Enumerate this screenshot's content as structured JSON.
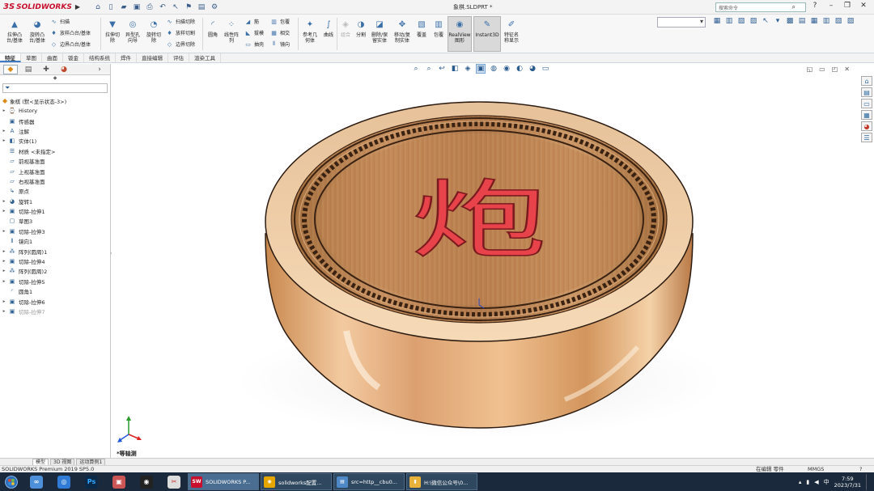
{
  "titlebar": {
    "app_brand": "SOLIDWORKS",
    "brand_prefix": "3S",
    "doc_title": "象棋.SLDPRT *",
    "search_placeholder": "搜索命令"
  },
  "ribbon": {
    "extrude_boss": "拉伸凸\n台/基体",
    "revolve_boss": "旋转凸\n台/基体",
    "sweep": "扫描",
    "loft_boss": "放样凸台/基体",
    "boundary_boss": "边界凸台/基体",
    "extrude_cut": "拉伸切\n除",
    "hole_wizard": "异型孔\n向导",
    "revolve_cut": "旋转切\n除",
    "sweep_cut": "扫描切除",
    "loft_cut": "放样切割",
    "boundary_cut": "边界切除",
    "fillet": "圆角",
    "linear_pattern": "线性阵\n列",
    "rib": "筋",
    "draft": "拔模",
    "shell": "抽壳",
    "wrap": "包覆",
    "intersect": "相交",
    "mirror": "镜向",
    "ref_geometry": "参考几\n何体",
    "curves": "曲线",
    "combine": "组合",
    "split": "分割",
    "delete_keep_body": "删除/保\n留实体",
    "move_copy_body": "移动/复\n制实体",
    "coat": "覆盖",
    "wrap2": "包覆",
    "realview": "RealView\n图形",
    "instant3d": "Instant3D",
    "feature_params": "特征名\n称显示"
  },
  "tabs": [
    "特征",
    "草图",
    "曲面",
    "钣金",
    "结构系统",
    "焊件",
    "直接编辑",
    "评估",
    "渲染工具"
  ],
  "tree": {
    "root": "象棋 (默<显示状态-3>)",
    "items": [
      {
        "label": "History",
        "exp": "▸",
        "icon": "history-icon",
        "glyph": "⌚"
      },
      {
        "label": "传感器",
        "exp": "",
        "icon": "sensor-icon",
        "glyph": "▣"
      },
      {
        "label": "注解",
        "exp": "▸",
        "icon": "annotation-icon",
        "glyph": "A"
      },
      {
        "label": "实体(1)",
        "exp": "▸",
        "icon": "solid-bodies-icon",
        "glyph": "◧"
      },
      {
        "label": "材质 <未指定>",
        "exp": "",
        "icon": "material-icon",
        "glyph": "☰"
      },
      {
        "label": "前视基准面",
        "exp": "",
        "icon": "plane-icon",
        "glyph": "▱"
      },
      {
        "label": "上视基准面",
        "exp": "",
        "icon": "plane-icon",
        "glyph": "▱"
      },
      {
        "label": "右视基准面",
        "exp": "",
        "icon": "plane-icon",
        "glyph": "▱"
      },
      {
        "label": "原点",
        "exp": "",
        "icon": "origin-icon",
        "glyph": "↳"
      },
      {
        "label": "旋转1",
        "exp": "▸",
        "icon": "revolve-icon",
        "glyph": "◕"
      },
      {
        "label": "切除-拉伸1",
        "exp": "▸",
        "icon": "extrude-cut-icon",
        "glyph": "▣"
      },
      {
        "label": "草图3",
        "exp": "",
        "icon": "sketch-icon",
        "glyph": "▢"
      },
      {
        "label": "切除-拉伸3",
        "exp": "▸",
        "icon": "extrude-cut-icon",
        "glyph": "▣"
      },
      {
        "label": "镜向1",
        "exp": "",
        "icon": "mirror-icon",
        "glyph": "⫴"
      },
      {
        "label": "阵列(圆周)1",
        "exp": "▸",
        "icon": "circular-pattern-icon",
        "glyph": "⁂"
      },
      {
        "label": "切除-拉伸4",
        "exp": "▸",
        "icon": "extrude-cut-icon",
        "glyph": "▣"
      },
      {
        "label": "阵列(圆周)2",
        "exp": "▸",
        "icon": "circular-pattern-icon",
        "glyph": "⁂"
      },
      {
        "label": "切除-拉伸5",
        "exp": "▸",
        "icon": "extrude-cut-icon",
        "glyph": "▣"
      },
      {
        "label": "圆角1",
        "exp": "",
        "icon": "fillet-icon",
        "glyph": "◜"
      },
      {
        "label": "切除-拉伸6",
        "exp": "▸",
        "icon": "extrude-cut-icon",
        "glyph": "▣"
      },
      {
        "label": "切除-拉伸7",
        "exp": "▸",
        "icon": "extrude-cut-icon",
        "glyph": "▣",
        "dim": true
      }
    ]
  },
  "viewport": {
    "piece_character": "炮",
    "view_label": "*等轴测"
  },
  "bottom_tabs": [
    "模型",
    "3D 视图",
    "运动算例1"
  ],
  "status": {
    "left": "SOLIDWORKS Premium 2019 SP5.0",
    "mode": "在编辑 零件",
    "units": "MMGS",
    "extra": "?"
  },
  "taskbar": {
    "tasks": [
      {
        "label": "SOLIDWORKS P...",
        "icon": "SW",
        "color": "#c8102e"
      },
      {
        "label": "solidworks配置...",
        "icon": "◉",
        "color": "#e6a600"
      },
      {
        "label": "src=http__cbu0...",
        "icon": "▤",
        "color": "#4f88c6"
      },
      {
        "label": "H:\\微信公众号\\0...",
        "icon": "▮",
        "color": "#e8b23a"
      }
    ],
    "time": "7:59",
    "date": "2023/7/31"
  },
  "colors": {
    "accent": "#3d7bc4",
    "brand": "#c8102e",
    "piece_red": "#e8434a"
  }
}
